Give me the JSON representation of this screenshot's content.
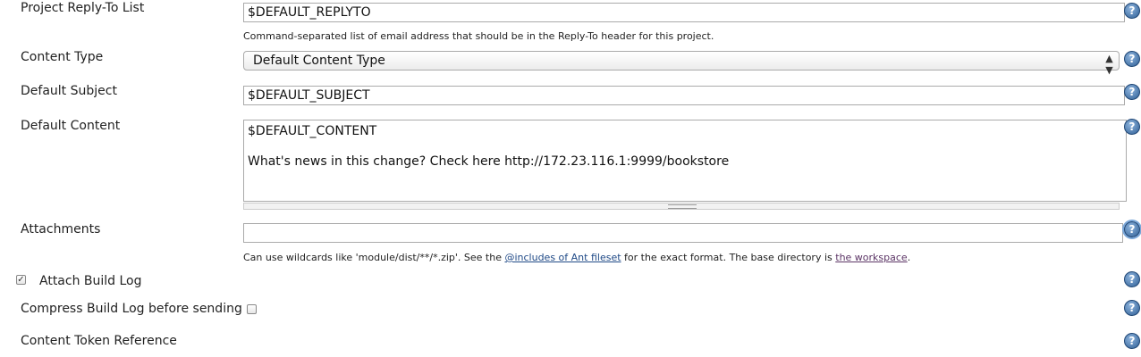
{
  "reply_to": {
    "label": "Project Reply-To List",
    "value": "$DEFAULT_REPLYTO",
    "description": "Command-separated list of email address that should be in the Reply-To header for this project."
  },
  "content_type": {
    "label": "Content Type",
    "selected": "Default Content Type"
  },
  "default_subject": {
    "label": "Default Subject",
    "value": "$DEFAULT_SUBJECT"
  },
  "default_content": {
    "label": "Default Content",
    "value": "$DEFAULT_CONTENT\n\nWhat's news in this change? Check here http://172.23.116.1:9999/bookstore"
  },
  "attachments": {
    "label": "Attachments",
    "value": "",
    "description_prefix": "Can use wildcards like 'module/dist/**/*.zip'. See the ",
    "link1": "@includes of Ant fileset",
    "description_middle": " for the exact format. The base directory is ",
    "link2": "the workspace",
    "description_suffix": "."
  },
  "attach_build_log": {
    "label": "Attach Build Log",
    "checked": true
  },
  "compress_build_log": {
    "label": "Compress Build Log before sending",
    "checked": false
  },
  "content_token_reference": {
    "label": "Content Token Reference"
  },
  "icons": {
    "help": "help-icon",
    "help_glyph": "?",
    "check_glyph": "✓",
    "select_arrows": "▲▼"
  }
}
